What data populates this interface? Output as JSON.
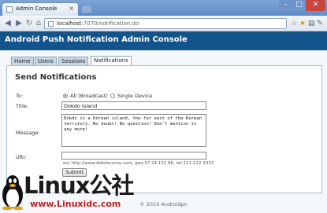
{
  "browser": {
    "tab_title": "Admin Console",
    "tab_close": "×",
    "url_host": "localhost",
    "url_path": ":7070/notification.do",
    "window_min": "–",
    "window_max": "□",
    "window_close": "✕",
    "icons": [
      "back-icon",
      "forward-icon",
      "reload-icon",
      "home-icon",
      "star-icon",
      "extension-icon",
      "page-menu-icon",
      "wrench-icon"
    ]
  },
  "header": {
    "title": "Android Push Notification Admin Console"
  },
  "nav_tabs": [
    {
      "label": "Home"
    },
    {
      "label": "Users"
    },
    {
      "label": "Sessions"
    },
    {
      "label": "Notifications",
      "active": true
    }
  ],
  "form": {
    "heading": "Send Notifications",
    "to_label": "To:",
    "to_options": [
      {
        "label": "All (Broadcast)",
        "selected": true
      },
      {
        "label": "Single Device",
        "selected": false
      }
    ],
    "title_label": "Title:",
    "title_value": "Dokdo Island",
    "message_label": "Message:",
    "message_value": "Dokdo is a Korean island, the far east of the Korean territory. No doubt! No question! Don't mention it any more!",
    "uri_label": "URI:",
    "uri_value": "",
    "uri_hint": "ex) http://www.dokdocorea.com, geo:37.24,131.86, tel:111-222-3333",
    "submit_label": "Submit"
  },
  "footer": {
    "text": "© 2010 Androidpn"
  },
  "watermark": {
    "big": "Linux公社",
    "small": "www.Linuxidc.com"
  },
  "colors": {
    "header_bg": "#14548c",
    "chrome": "#6d95cb",
    "panel_border": "#a9bfd0"
  }
}
